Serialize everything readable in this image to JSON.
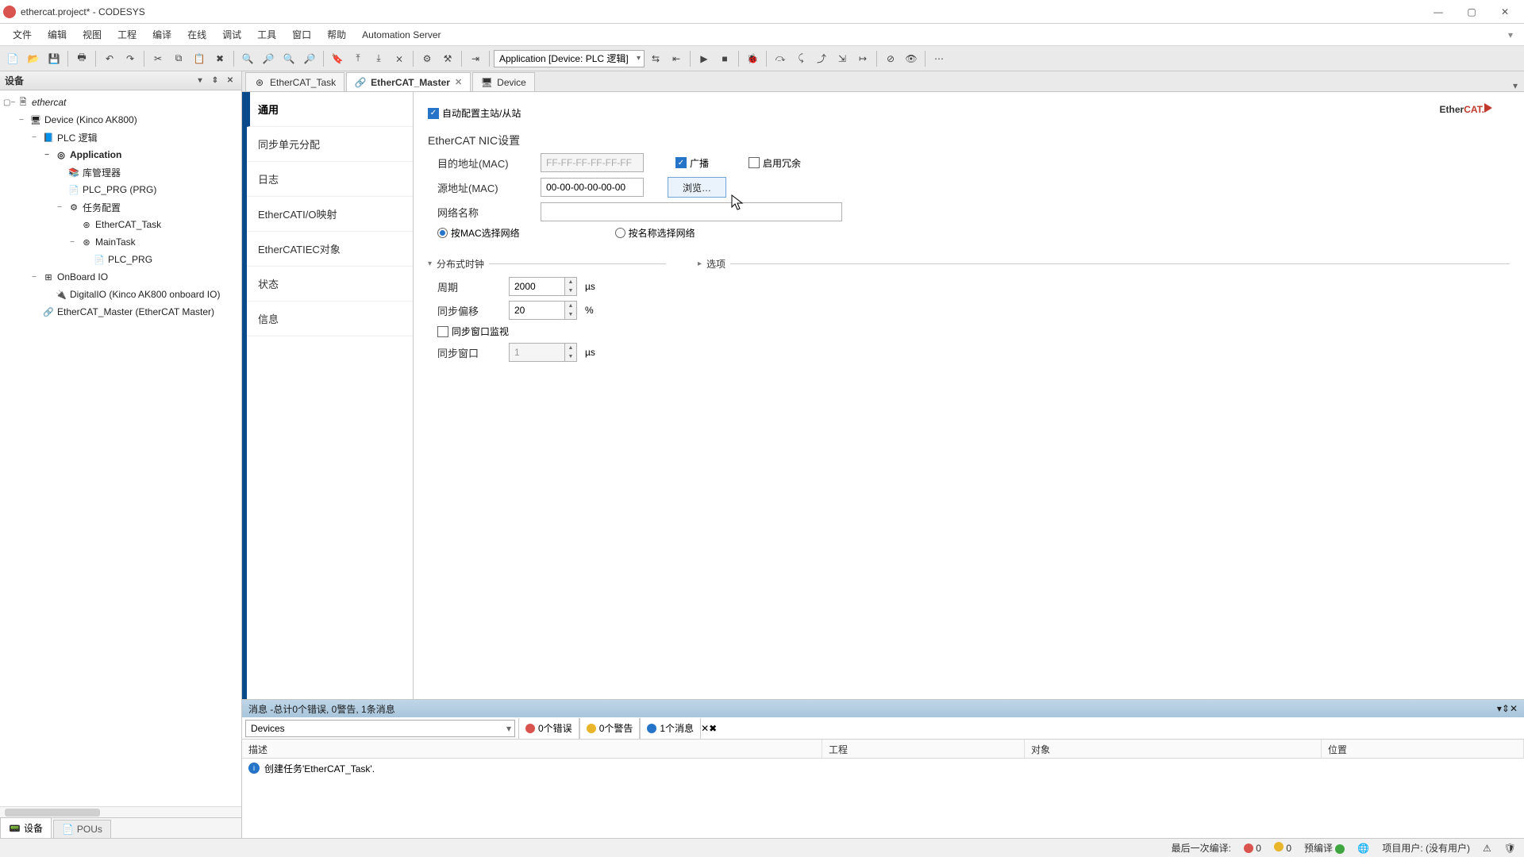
{
  "window": {
    "title": "ethercat.project* - CODESYS"
  },
  "menu": {
    "file": "文件",
    "edit": "编辑",
    "view": "视图",
    "project": "工程",
    "build": "编译",
    "online": "在线",
    "debug": "调试",
    "tools": "工具",
    "window": "窗口",
    "help": "帮助",
    "automation": "Automation Server"
  },
  "toolbar": {
    "combo": "Application [Device: PLC 逻辑]"
  },
  "device_panel": {
    "title": "设备"
  },
  "tree": {
    "root": "ethercat",
    "device": "Device (Kinco AK800)",
    "plclogic": "PLC 逻辑",
    "app": "Application",
    "libmgr": "库管理器",
    "plc_prg_pou": "PLC_PRG (PRG)",
    "taskcfg": "任务配置",
    "ectask": "EtherCAT_Task",
    "maintask": "MainTask",
    "plc_prg": "PLC_PRG",
    "onboard": "OnBoard IO",
    "digio": "DigitalIO (Kinco AK800 onboard IO)",
    "ecmaster": "EtherCAT_Master (EtherCAT Master)"
  },
  "side_tabs": {
    "devices": "设备",
    "pous": "POUs"
  },
  "tabs": {
    "t1": "EtherCAT_Task",
    "t2": "EtherCAT_Master",
    "t3": "Device"
  },
  "nav": {
    "general": "通用",
    "sync": "同步单元分配",
    "log": "日志",
    "iomap": "EtherCATI/O映射",
    "iec": "EtherCATIEC对象",
    "status": "状态",
    "info": "信息"
  },
  "form": {
    "auto_cfg": "自动配置主站/从站",
    "nic_title": "EtherCAT  NIC设置",
    "dst_mac_lbl": "目的地址(MAC)",
    "dst_mac_val": "FF-FF-FF-FF-FF-FF",
    "broadcast": "广播",
    "redundancy": "启用冗余",
    "src_mac_lbl": "源地址(MAC)",
    "src_mac_val": "00-00-00-00-00-00",
    "browse": "浏览…",
    "net_name_lbl": "网络名称",
    "net_name_val": "",
    "sel_by_mac": "按MAC选择网络",
    "sel_by_name": "按名称选择网络",
    "dc_title": "分布式时钟",
    "options_title": "选项",
    "period_lbl": "周期",
    "period_val": "2000",
    "us": "µs",
    "offset_lbl": "同步偏移",
    "offset_val": "20",
    "pct": "%",
    "syncwin_mon": "同步窗口监视",
    "syncwin_lbl": "同步窗口",
    "syncwin_val": "1",
    "brand_a": "Ether",
    "brand_b": "CAT."
  },
  "messages": {
    "title": "消息 -总计0个错误, 0警告, 1条消息",
    "scope": "Devices",
    "errs": "0个错误",
    "warns": "0个警告",
    "infos": "1个消息",
    "col_desc": "描述",
    "col_proj": "工程",
    "col_obj": "对象",
    "col_pos": "位置",
    "row1": "创建任务'EtherCAT_Task'."
  },
  "status": {
    "last_build": "最后一次编译:",
    "e": "0",
    "w": "0",
    "precompile": "预编译 ",
    "user_lbl": "项目用户:",
    "user_val": "(没有用户)"
  }
}
